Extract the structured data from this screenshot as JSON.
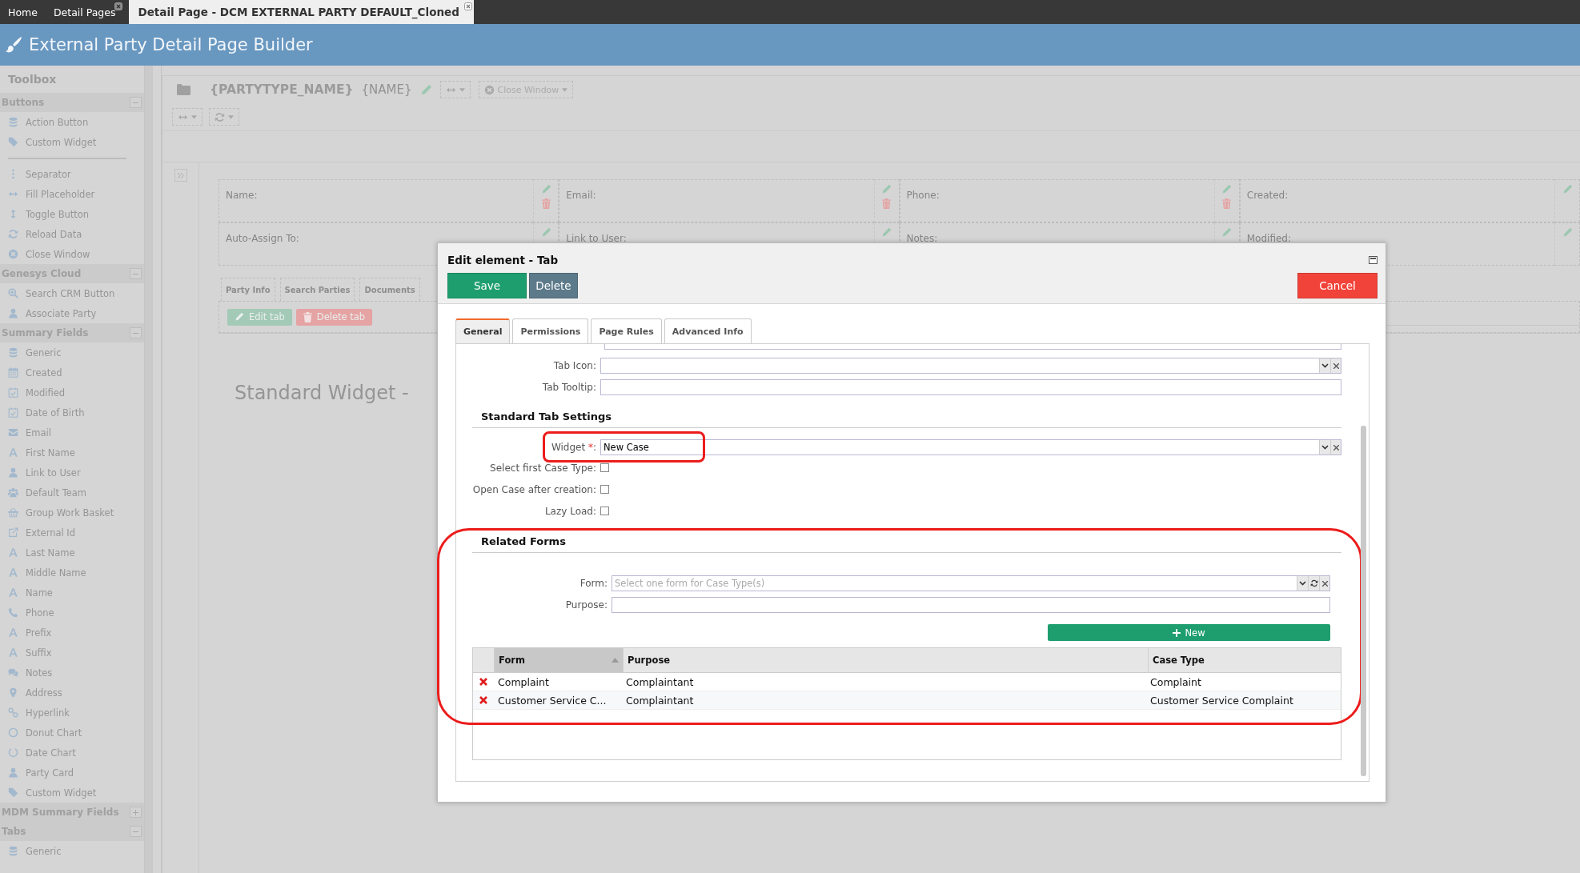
{
  "top_tabs": [
    {
      "label": "Home",
      "selected": false,
      "closable": false
    },
    {
      "label": "Detail Pages",
      "selected": false,
      "closable": true
    },
    {
      "label": "Detail Page - DCM EXTERNAL PARTY DEFAULT_Cloned",
      "selected": true,
      "closable": true
    }
  ],
  "header": {
    "title": "External Party Detail Page Builder"
  },
  "toolbox": {
    "title": "Toolbox",
    "sections": [
      {
        "title": "Buttons",
        "expanded": true,
        "items": [
          {
            "label": "Action Button",
            "kind": "database"
          },
          {
            "label": "Custom Widget",
            "kind": "tag"
          }
        ],
        "more_items": [
          {
            "label": "Separator",
            "kind": "dots"
          },
          {
            "label": "Fill Placeholder",
            "kind": "harrow"
          },
          {
            "label": "Toggle Button",
            "kind": "varrow"
          },
          {
            "label": "Reload Data",
            "kind": "refresh"
          },
          {
            "label": "Close Window",
            "kind": "close"
          }
        ]
      },
      {
        "title": "Genesys Cloud",
        "expanded": true,
        "items": [
          {
            "label": "Search CRM Button",
            "kind": "search"
          },
          {
            "label": "Associate Party",
            "kind": "user"
          }
        ]
      },
      {
        "title": "Summary Fields",
        "expanded": true,
        "items": [
          {
            "label": "Generic",
            "kind": "database"
          },
          {
            "label": "Created",
            "kind": "calendar"
          },
          {
            "label": "Modified",
            "kind": "calendar-check"
          },
          {
            "label": "Date of Birth",
            "kind": "calendar-check"
          },
          {
            "label": "Email",
            "kind": "mail"
          },
          {
            "label": "First Name",
            "kind": "font"
          },
          {
            "label": "Link to User",
            "kind": "user"
          },
          {
            "label": "Default Team",
            "kind": "users"
          },
          {
            "label": "Group Work Basket",
            "kind": "basket"
          },
          {
            "label": "External Id",
            "kind": "external"
          },
          {
            "label": "Last Name",
            "kind": "font"
          },
          {
            "label": "Middle Name",
            "kind": "font"
          },
          {
            "label": "Name",
            "kind": "font"
          },
          {
            "label": "Phone",
            "kind": "phone"
          },
          {
            "label": "Prefix",
            "kind": "font"
          },
          {
            "label": "Suffix",
            "kind": "font"
          },
          {
            "label": "Notes",
            "kind": "comments"
          },
          {
            "label": "Address",
            "kind": "pin"
          },
          {
            "label": "Hyperlink",
            "kind": "link"
          },
          {
            "label": "Donut Chart",
            "kind": "circle"
          },
          {
            "label": "Date Chart",
            "kind": "ring"
          },
          {
            "label": "Party Card",
            "kind": "user"
          },
          {
            "label": "Custom Widget",
            "kind": "tag"
          }
        ]
      },
      {
        "title": "MDM Summary Fields",
        "expanded": false
      },
      {
        "title": "Tabs",
        "expanded": true,
        "items": [
          {
            "label": "Generic",
            "kind": "database"
          }
        ]
      }
    ]
  },
  "page_toolbar": {
    "title": "{PARTYTYPE_NAME}",
    "subtitle": "{NAME}",
    "close_button": "Close Window"
  },
  "summary_rows": [
    [
      {
        "label": "Name:",
        "removable": true
      },
      {
        "label": "Email:",
        "removable": true
      },
      {
        "label": "Phone:",
        "removable": true
      },
      {
        "label": "Created:",
        "removable": false
      }
    ],
    [
      {
        "label": "Auto-Assign To:",
        "removable": false
      },
      {
        "label": "Link to User:",
        "removable": false
      },
      {
        "label": "Notes:",
        "removable": false
      },
      {
        "label": "Modified:",
        "removable": false
      }
    ]
  ],
  "page_tabs": [
    {
      "label": "Party Info"
    },
    {
      "label": "Search Parties"
    },
    {
      "label": "Documents"
    }
  ],
  "tab_actions": [
    {
      "label": "Edit tab",
      "kind": "edit"
    },
    {
      "label": "Delete tab",
      "kind": "delete"
    }
  ],
  "widget_title": "Standard Widget -",
  "dialog": {
    "title": "Edit element - Tab",
    "buttons": [
      {
        "label": "Save",
        "kind": "save"
      },
      {
        "label": "Delete",
        "kind": "delete"
      },
      {
        "label": "Cancel",
        "kind": "cancel"
      }
    ],
    "tabs": [
      {
        "label": "General",
        "selected": true
      },
      {
        "label": "Permissions",
        "selected": false
      },
      {
        "label": "Page Rules",
        "selected": false
      },
      {
        "label": "Advanced Info",
        "selected": false
      }
    ],
    "fields": [
      {
        "label": "Tab Icon:",
        "kind": "select"
      },
      {
        "label": "Tab Tooltip:",
        "kind": "text"
      }
    ],
    "standard_settings": {
      "title": "Standard Tab Settings",
      "widget": {
        "label": "Widget",
        "required_mark": "*",
        "label_end": ":",
        "value": "New Case",
        "highlighted": true
      },
      "options": [
        {
          "label": "Select first Case Type:",
          "checked": false
        },
        {
          "label": "Open Case after creation:",
          "checked": false
        },
        {
          "label": "Lazy Load:",
          "checked": false
        }
      ]
    },
    "related_forms": {
      "title": "Related Forms",
      "highlighted": true,
      "form_field": {
        "label": "Form:",
        "placeholder": "Select one form for Case Type(s)"
      },
      "purpose_field": {
        "label": "Purpose:"
      },
      "new_button": "New",
      "columns": [
        {
          "label": "Form",
          "sorted": true
        },
        {
          "label": "Purpose",
          "sorted": false
        },
        {
          "label": "Case Type",
          "sorted": false
        }
      ],
      "rows": [
        [
          "Complaint",
          "Complaintant",
          "Complaint"
        ],
        [
          "Customer Service C...",
          "Complaintant",
          "Customer Service Complaint"
        ]
      ]
    }
  }
}
